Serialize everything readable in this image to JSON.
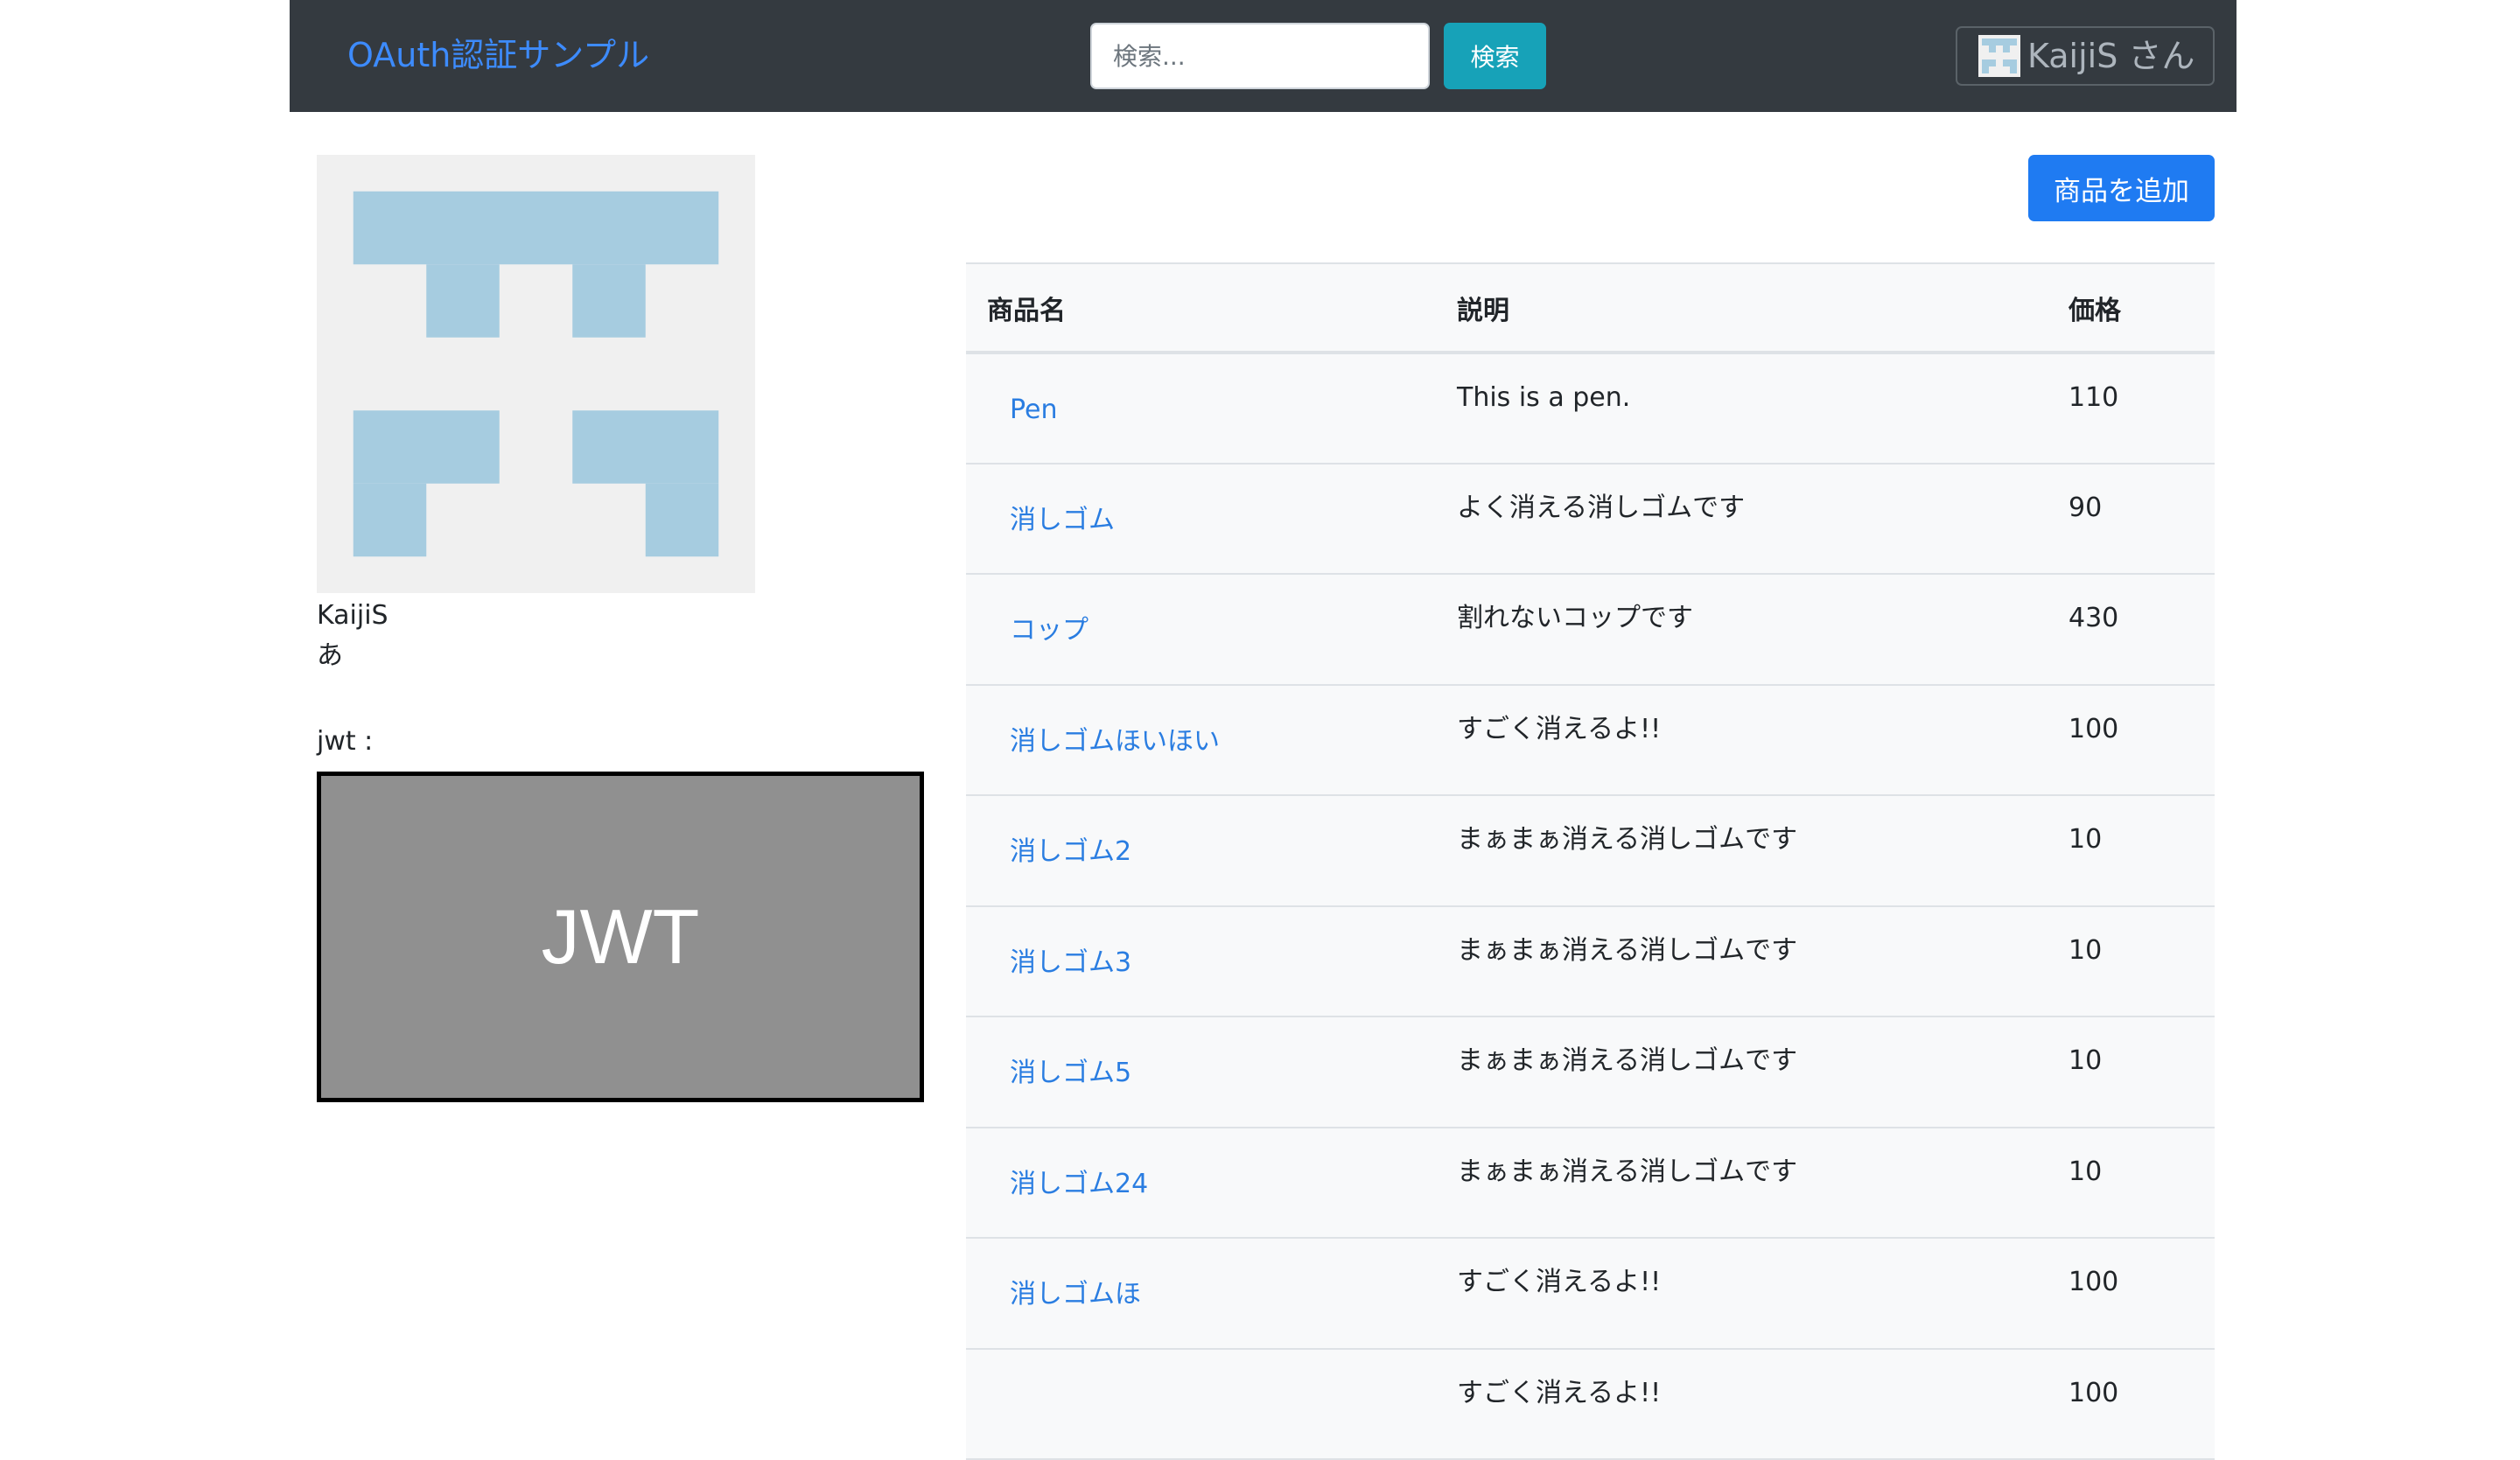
{
  "navbar": {
    "brand": "OAuth認証サンプル",
    "search_placeholder": "検索...",
    "search_value": "",
    "search_button": "検索",
    "user_label": "KaijiS さん"
  },
  "profile": {
    "avatar": "identicon",
    "username": "KaijiS",
    "description": "あ",
    "jwt_label": "jwt :",
    "jwt_image_text": "JWT"
  },
  "actions": {
    "add_product": "商品を追加"
  },
  "colors": {
    "navbar_bg": "#343a40",
    "brand": "#3d8bfd",
    "search_button": "#17a2b8",
    "add_button": "#1f7bf2",
    "link": "#2a7de1",
    "identicon_bg": "#f0f0f0",
    "identicon_fg": "#a6cce0",
    "jwt_box": "#909090"
  },
  "table": {
    "headers": [
      "商品名",
      "説明",
      "価格"
    ],
    "rows": [
      {
        "name": "Pen",
        "description": "This is a pen.",
        "price": "110"
      },
      {
        "name": "消しゴム",
        "description": "よく消える消しゴムです",
        "price": "90"
      },
      {
        "name": "コップ",
        "description": "割れないコップです",
        "price": "430"
      },
      {
        "name": "消しゴムほいほい",
        "description": "すごく消えるよ!!",
        "price": "100"
      },
      {
        "name": "消しゴム2",
        "description": "まぁまぁ消える消しゴムです",
        "price": "10"
      },
      {
        "name": "消しゴム3",
        "description": "まぁまぁ消える消しゴムです",
        "price": "10"
      },
      {
        "name": "消しゴム5",
        "description": "まぁまぁ消える消しゴムです",
        "price": "10"
      },
      {
        "name": "消しゴム24",
        "description": "まぁまぁ消える消しゴムです",
        "price": "10"
      },
      {
        "name": "消しゴムほ",
        "description": "すごく消えるよ!!",
        "price": "100"
      },
      {
        "name": "",
        "description": "すごく消えるよ!!",
        "price": "100"
      }
    ]
  }
}
